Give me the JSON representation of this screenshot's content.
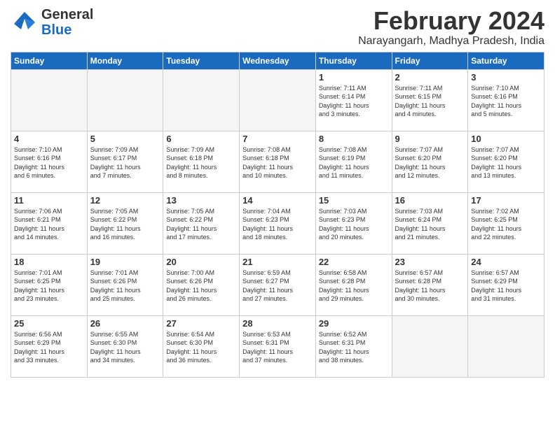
{
  "header": {
    "logo_general": "General",
    "logo_blue": "Blue",
    "month_year": "February 2024",
    "location": "Narayangarh, Madhya Pradesh, India"
  },
  "days_of_week": [
    "Sunday",
    "Monday",
    "Tuesday",
    "Wednesday",
    "Thursday",
    "Friday",
    "Saturday"
  ],
  "weeks": [
    [
      {
        "day": "",
        "info": ""
      },
      {
        "day": "",
        "info": ""
      },
      {
        "day": "",
        "info": ""
      },
      {
        "day": "",
        "info": ""
      },
      {
        "day": "1",
        "info": "Sunrise: 7:11 AM\nSunset: 6:14 PM\nDaylight: 11 hours\nand 3 minutes."
      },
      {
        "day": "2",
        "info": "Sunrise: 7:11 AM\nSunset: 6:15 PM\nDaylight: 11 hours\nand 4 minutes."
      },
      {
        "day": "3",
        "info": "Sunrise: 7:10 AM\nSunset: 6:16 PM\nDaylight: 11 hours\nand 5 minutes."
      }
    ],
    [
      {
        "day": "4",
        "info": "Sunrise: 7:10 AM\nSunset: 6:16 PM\nDaylight: 11 hours\nand 6 minutes."
      },
      {
        "day": "5",
        "info": "Sunrise: 7:09 AM\nSunset: 6:17 PM\nDaylight: 11 hours\nand 7 minutes."
      },
      {
        "day": "6",
        "info": "Sunrise: 7:09 AM\nSunset: 6:18 PM\nDaylight: 11 hours\nand 8 minutes."
      },
      {
        "day": "7",
        "info": "Sunrise: 7:08 AM\nSunset: 6:18 PM\nDaylight: 11 hours\nand 10 minutes."
      },
      {
        "day": "8",
        "info": "Sunrise: 7:08 AM\nSunset: 6:19 PM\nDaylight: 11 hours\nand 11 minutes."
      },
      {
        "day": "9",
        "info": "Sunrise: 7:07 AM\nSunset: 6:20 PM\nDaylight: 11 hours\nand 12 minutes."
      },
      {
        "day": "10",
        "info": "Sunrise: 7:07 AM\nSunset: 6:20 PM\nDaylight: 11 hours\nand 13 minutes."
      }
    ],
    [
      {
        "day": "11",
        "info": "Sunrise: 7:06 AM\nSunset: 6:21 PM\nDaylight: 11 hours\nand 14 minutes."
      },
      {
        "day": "12",
        "info": "Sunrise: 7:05 AM\nSunset: 6:22 PM\nDaylight: 11 hours\nand 16 minutes."
      },
      {
        "day": "13",
        "info": "Sunrise: 7:05 AM\nSunset: 6:22 PM\nDaylight: 11 hours\nand 17 minutes."
      },
      {
        "day": "14",
        "info": "Sunrise: 7:04 AM\nSunset: 6:23 PM\nDaylight: 11 hours\nand 18 minutes."
      },
      {
        "day": "15",
        "info": "Sunrise: 7:03 AM\nSunset: 6:23 PM\nDaylight: 11 hours\nand 20 minutes."
      },
      {
        "day": "16",
        "info": "Sunrise: 7:03 AM\nSunset: 6:24 PM\nDaylight: 11 hours\nand 21 minutes."
      },
      {
        "day": "17",
        "info": "Sunrise: 7:02 AM\nSunset: 6:25 PM\nDaylight: 11 hours\nand 22 minutes."
      }
    ],
    [
      {
        "day": "18",
        "info": "Sunrise: 7:01 AM\nSunset: 6:25 PM\nDaylight: 11 hours\nand 23 minutes."
      },
      {
        "day": "19",
        "info": "Sunrise: 7:01 AM\nSunset: 6:26 PM\nDaylight: 11 hours\nand 25 minutes."
      },
      {
        "day": "20",
        "info": "Sunrise: 7:00 AM\nSunset: 6:26 PM\nDaylight: 11 hours\nand 26 minutes."
      },
      {
        "day": "21",
        "info": "Sunrise: 6:59 AM\nSunset: 6:27 PM\nDaylight: 11 hours\nand 27 minutes."
      },
      {
        "day": "22",
        "info": "Sunrise: 6:58 AM\nSunset: 6:28 PM\nDaylight: 11 hours\nand 29 minutes."
      },
      {
        "day": "23",
        "info": "Sunrise: 6:57 AM\nSunset: 6:28 PM\nDaylight: 11 hours\nand 30 minutes."
      },
      {
        "day": "24",
        "info": "Sunrise: 6:57 AM\nSunset: 6:29 PM\nDaylight: 11 hours\nand 31 minutes."
      }
    ],
    [
      {
        "day": "25",
        "info": "Sunrise: 6:56 AM\nSunset: 6:29 PM\nDaylight: 11 hours\nand 33 minutes."
      },
      {
        "day": "26",
        "info": "Sunrise: 6:55 AM\nSunset: 6:30 PM\nDaylight: 11 hours\nand 34 minutes."
      },
      {
        "day": "27",
        "info": "Sunrise: 6:54 AM\nSunset: 6:30 PM\nDaylight: 11 hours\nand 36 minutes."
      },
      {
        "day": "28",
        "info": "Sunrise: 6:53 AM\nSunset: 6:31 PM\nDaylight: 11 hours\nand 37 minutes."
      },
      {
        "day": "29",
        "info": "Sunrise: 6:52 AM\nSunset: 6:31 PM\nDaylight: 11 hours\nand 38 minutes."
      },
      {
        "day": "",
        "info": ""
      },
      {
        "day": "",
        "info": ""
      }
    ]
  ]
}
